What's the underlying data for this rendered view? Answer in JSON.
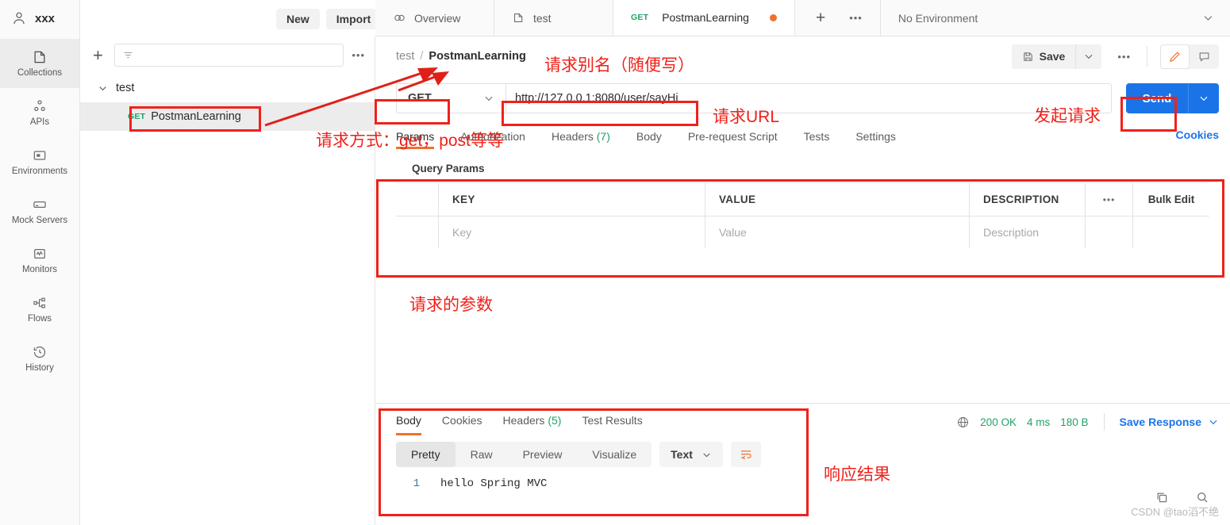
{
  "rail": {
    "user": "xxx",
    "new_label": "New",
    "import_label": "Import",
    "items": [
      {
        "label": "Collections",
        "icon": "collections-icon"
      },
      {
        "label": "APIs",
        "icon": "apis-icon"
      },
      {
        "label": "Environments",
        "icon": "environments-icon"
      },
      {
        "label": "Mock Servers",
        "icon": "mock-servers-icon"
      },
      {
        "label": "Monitors",
        "icon": "monitors-icon"
      },
      {
        "label": "Flows",
        "icon": "flows-icon"
      },
      {
        "label": "History",
        "icon": "history-icon"
      }
    ]
  },
  "sidebar": {
    "filter_placeholder": "",
    "collection": "test",
    "request": {
      "method": "GET",
      "name": "PostmanLearning"
    }
  },
  "tabbar": {
    "tabs": [
      {
        "label": "Overview",
        "icon": "overview-icon",
        "method": ""
      },
      {
        "label": "test",
        "icon": "collection-icon",
        "method": ""
      },
      {
        "label": "PostmanLearning",
        "icon": "",
        "method": "GET"
      }
    ],
    "environment": "No Environment"
  },
  "breadcrumb": {
    "parent": "test",
    "separator": "/",
    "current": "PostmanLearning"
  },
  "toolbar": {
    "save_label": "Save",
    "save_icon": "floppy-icon",
    "dots": "•••",
    "edit_icon": "pencil-icon",
    "comment_icon": "comment-icon"
  },
  "request": {
    "method": "GET",
    "url": "http://127.0.0.1:8080/user/sayHi",
    "send_label": "Send",
    "tabs": [
      {
        "label": "Params",
        "count": ""
      },
      {
        "label": "Authorization",
        "count": ""
      },
      {
        "label": "Headers",
        "count": "(7)"
      },
      {
        "label": "Body",
        "count": ""
      },
      {
        "label": "Pre-request Script",
        "count": ""
      },
      {
        "label": "Tests",
        "count": ""
      },
      {
        "label": "Settings",
        "count": ""
      }
    ],
    "cookies_link": "Cookies"
  },
  "query_params": {
    "title": "Query Params",
    "columns": [
      "KEY",
      "VALUE",
      "DESCRIPTION"
    ],
    "dots": "•••",
    "bulk_edit": "Bulk Edit",
    "placeholder_row": {
      "key": "Key",
      "value": "Value",
      "description": "Description"
    }
  },
  "response": {
    "tabs": [
      {
        "label": "Body",
        "count": ""
      },
      {
        "label": "Cookies",
        "count": ""
      },
      {
        "label": "Headers",
        "count": "(5)"
      },
      {
        "label": "Test Results",
        "count": ""
      }
    ],
    "status": "200 OK",
    "time": "4 ms",
    "size": "180 B",
    "save_response": "Save Response",
    "formats": [
      "Pretty",
      "Raw",
      "Preview",
      "Visualize"
    ],
    "active_format": "Pretty",
    "type": "Text",
    "body_lines": [
      {
        "no": "1",
        "text": "hello Spring MVC"
      }
    ],
    "copy_icon": "copy-icon",
    "search_icon": "search-icon"
  },
  "annotations": {
    "alias": "请求别名（随便写）",
    "method": "请求方式：get，post等等",
    "url": "请求URL",
    "send": "发起请求",
    "params": "请求的参数",
    "result": "响应结果"
  },
  "watermark": "CSDN @tao滔不绝",
  "colors": {
    "accent": "#f0712a",
    "send": "#1a74e8",
    "get": "#21a366",
    "annotation": "#f0211a"
  }
}
